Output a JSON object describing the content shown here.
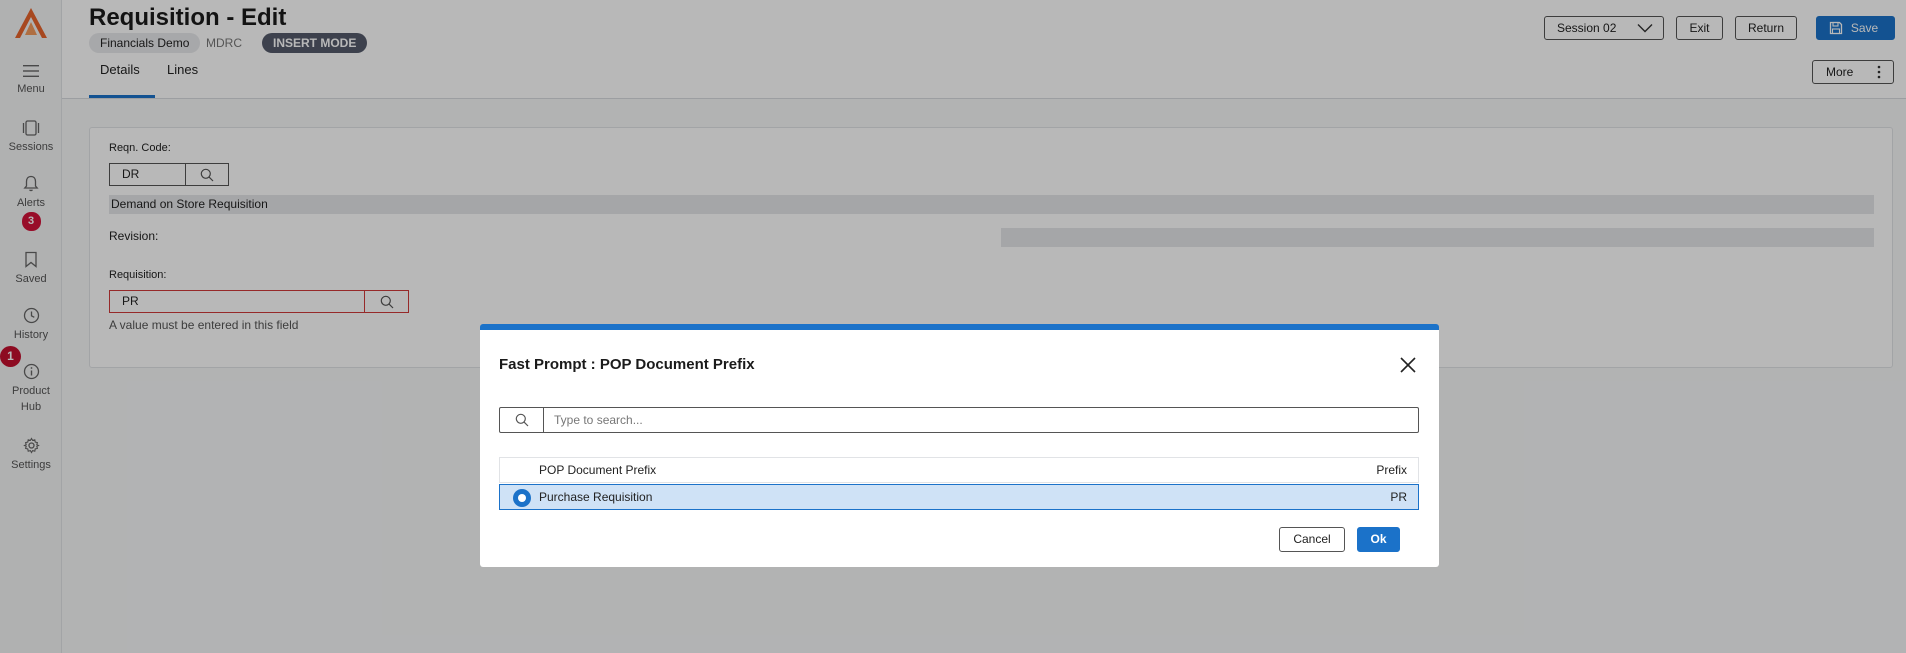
{
  "sidebar": {
    "items": [
      {
        "label": "Menu",
        "icon": "menu-icon"
      },
      {
        "label": "Sessions",
        "icon": "sessions-icon"
      },
      {
        "label": "Alerts",
        "icon": "bell-icon",
        "badge": "3"
      },
      {
        "label": "Saved",
        "icon": "bookmark-icon"
      },
      {
        "label": "History",
        "icon": "clock-icon"
      },
      {
        "label": "Product",
        "label2": "Hub",
        "icon": "info-icon",
        "badge": "1"
      },
      {
        "label": "Settings",
        "icon": "gear-icon"
      }
    ]
  },
  "header": {
    "title": "Requisition - Edit",
    "company": "Financials Demo",
    "code": "MDRC",
    "mode": "INSERT MODE",
    "session": "Session 02",
    "exit": "Exit",
    "return": "Return",
    "save": "Save",
    "more": "More",
    "tabs": [
      "Details",
      "Lines"
    ]
  },
  "form": {
    "reqn_code_label": "Reqn. Code:",
    "reqn_code_value": "DR",
    "reqn_description": "Demand on Store Requisition",
    "revision_label": "Revision:",
    "requisition_label": "Requisition:",
    "requisition_value": "PR",
    "requisition_error": "A value must be entered in this field"
  },
  "modal": {
    "title": "Fast Prompt : POP Document Prefix",
    "search_placeholder": "Type to search...",
    "columns": {
      "name": "POP Document Prefix",
      "prefix": "Prefix"
    },
    "rows": [
      {
        "name": "Purchase Requisition",
        "prefix": "PR",
        "selected": true
      }
    ],
    "cancel": "Cancel",
    "ok": "Ok"
  },
  "colors": {
    "accent": "#1b72c9",
    "error": "#d03a3a",
    "badge": "#d3123a",
    "logo": "#e8642c"
  }
}
